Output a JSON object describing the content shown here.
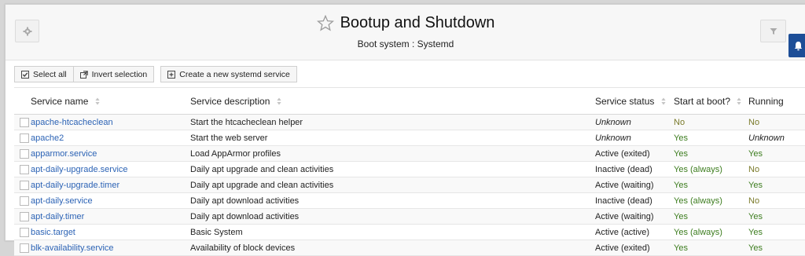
{
  "header": {
    "title": "Bootup and Shutdown",
    "subtitle": "Boot system : Systemd"
  },
  "toolbar": {
    "select_all": "Select all",
    "invert_selection": "Invert selection",
    "create_service": "Create a new systemd service"
  },
  "table": {
    "columns": [
      "Service name",
      "Service description",
      "Service status",
      "Start at boot?",
      "Running"
    ],
    "rows": [
      {
        "name": "apache-htcacheclean",
        "description": "Start the htcacheclean helper",
        "status": "Unknown",
        "boot": "No",
        "running": "No"
      },
      {
        "name": "apache2",
        "description": "Start the web server",
        "status": "Unknown",
        "boot": "Yes",
        "running": "Unknown"
      },
      {
        "name": "apparmor.service",
        "description": "Load AppArmor profiles",
        "status": "Active (exited)",
        "boot": "Yes",
        "running": "Yes"
      },
      {
        "name": "apt-daily-upgrade.service",
        "description": "Daily apt upgrade and clean activities",
        "status": "Inactive (dead)",
        "boot": "Yes (always)",
        "running": "No"
      },
      {
        "name": "apt-daily-upgrade.timer",
        "description": "Daily apt upgrade and clean activities",
        "status": "Active (waiting)",
        "boot": "Yes",
        "running": "Yes"
      },
      {
        "name": "apt-daily.service",
        "description": "Daily apt download activities",
        "status": "Inactive (dead)",
        "boot": "Yes (always)",
        "running": "No"
      },
      {
        "name": "apt-daily.timer",
        "description": "Daily apt download activities",
        "status": "Active (waiting)",
        "boot": "Yes",
        "running": "Yes"
      },
      {
        "name": "basic.target",
        "description": "Basic System",
        "status": "Active (active)",
        "boot": "Yes (always)",
        "running": "Yes"
      },
      {
        "name": "blk-availability.service",
        "description": "Availability of block devices",
        "status": "Active (exited)",
        "boot": "Yes",
        "running": "Yes"
      }
    ]
  },
  "colors": {
    "link": "#2c63b5",
    "yes": "#3d7d1f",
    "no": "#7a7a2a",
    "side_tab": "#1d4e97"
  },
  "icons": [
    "gear-icon",
    "star-icon",
    "filter-icon",
    "bell-icon",
    "check-icon",
    "invert-icon",
    "plus-square-icon",
    "sort-icon"
  ]
}
